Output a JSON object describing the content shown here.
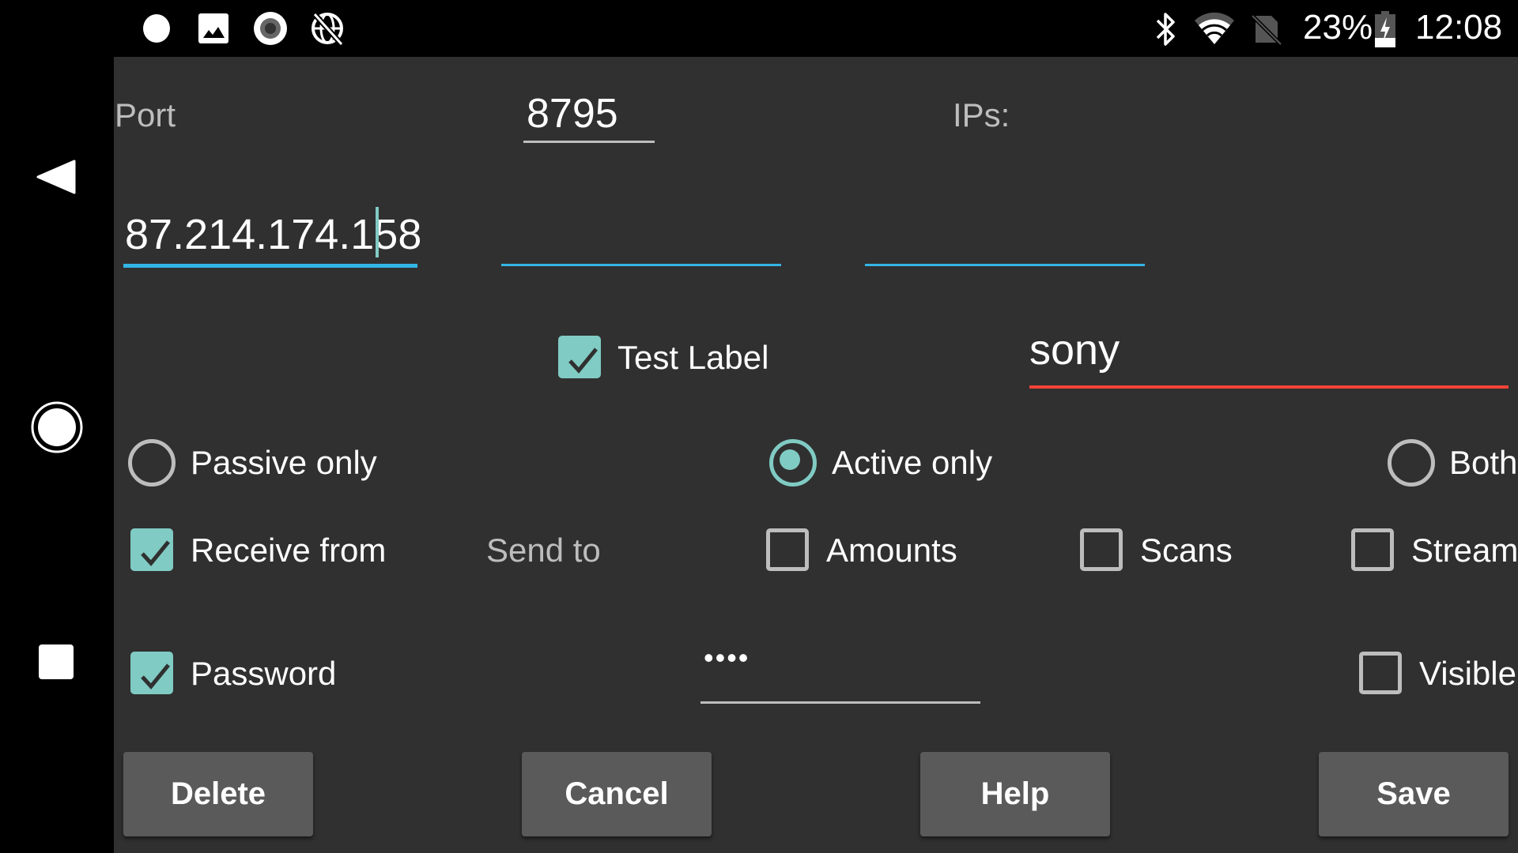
{
  "status_bar": {
    "left_icons": [
      "notification-dot-icon",
      "image-icon",
      "record-icon",
      "globe-off-icon"
    ],
    "right_icons": [
      "bluetooth-icon",
      "wifi-icon",
      "no-sim-icon",
      "battery-charging-icon"
    ],
    "battery_percent": "23%",
    "time": "12:08"
  },
  "nav_bar": {
    "back": "back-icon",
    "home": "home-icon",
    "recents": "recents-icon"
  },
  "form": {
    "port_label": "Port",
    "port_value": "8795",
    "ips_label": "IPs:",
    "ip_fields": [
      {
        "value": "87.214.174.158"
      },
      {
        "value": ""
      },
      {
        "value": ""
      }
    ],
    "test_label": {
      "label": "Test Label",
      "checked": true
    },
    "name_value": "sony",
    "mode_options": [
      {
        "label": "Passive only",
        "selected": false
      },
      {
        "label": "Active only",
        "selected": true
      },
      {
        "label": "Both",
        "selected": false
      }
    ],
    "receive_from": {
      "label": "Receive from",
      "checked": true
    },
    "send_to_label": "Send to",
    "send_options": [
      {
        "label": "Amounts",
        "checked": false
      },
      {
        "label": "Scans",
        "checked": false
      },
      {
        "label": "Stream",
        "checked": false
      }
    ],
    "password": {
      "label": "Password",
      "checked": true,
      "value": "••••"
    },
    "visible": {
      "label": "Visible",
      "checked": false
    }
  },
  "buttons": {
    "delete": "Delete",
    "cancel": "Cancel",
    "help": "Help",
    "save": "Save"
  },
  "colors": {
    "accent": "#80cbc4",
    "focus_underline": "#33b5e5",
    "error_underline": "#f44336",
    "background": "#303030",
    "button": "#5a5a5b"
  }
}
